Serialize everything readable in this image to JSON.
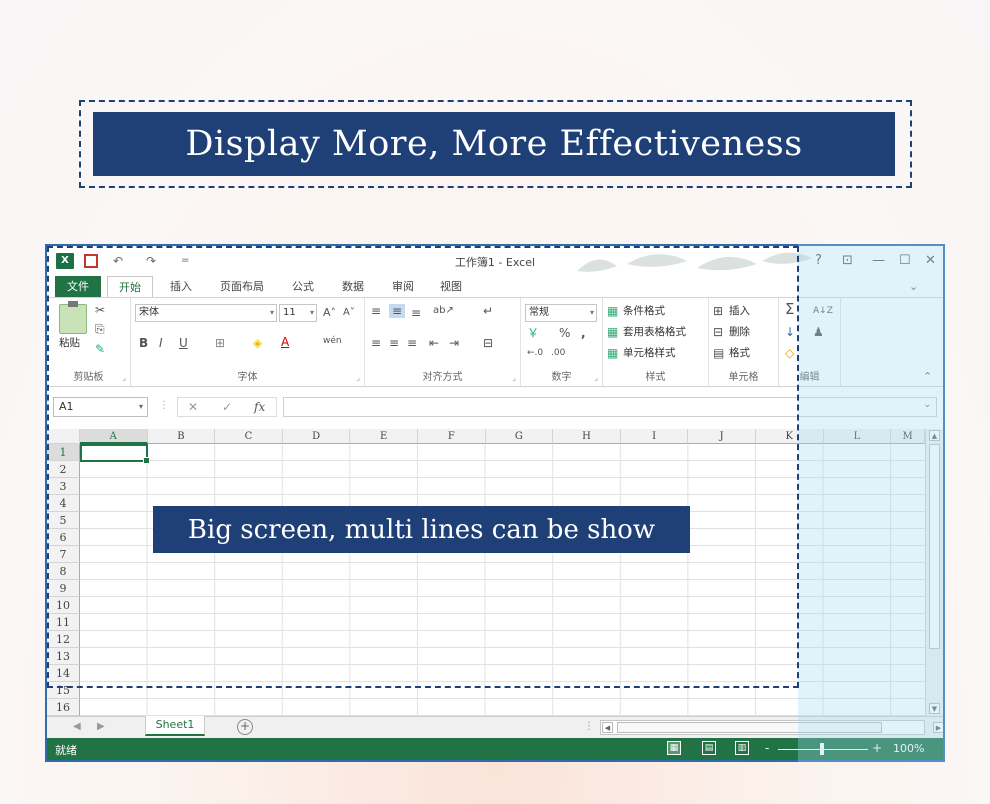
{
  "banner": {
    "title": "Display More, More Effectiveness"
  },
  "callout": {
    "text": "Big screen, multi lines can be show"
  },
  "window": {
    "title": "工作簿1 - Excel",
    "logo": "X",
    "undo": "↶",
    "redo": "↷",
    "qat_more": "=",
    "help": "?",
    "options": "⊡",
    "minimize": "—",
    "maximize": "☐",
    "close": "✕"
  },
  "tabs": [
    "文件",
    "开始",
    "插入",
    "页面布局",
    "公式",
    "数据",
    "审阅",
    "视图"
  ],
  "ribbon": {
    "clipboard": {
      "label": "剪贴板",
      "paste": "粘贴",
      "cut": "✂",
      "copy": "⎘",
      "painter": "✎"
    },
    "font": {
      "label": "字体",
      "name": "宋体",
      "size": "11",
      "grow": "A˄",
      "shrink": "A˅",
      "bold": "B",
      "italic": "I",
      "underline": "U",
      "border": "⊞",
      "fill": "◈",
      "color": "A",
      "phonetic": "wén"
    },
    "alignment": {
      "label": "对齐方式",
      "top": "≡",
      "middle": "≡",
      "bottom": "≡",
      "orient": "ab↗",
      "left": "≡",
      "center": "≡",
      "right": "≡",
      "outdent": "⇤",
      "indent": "⇥",
      "wrap": "↵",
      "merge": "⊟"
    },
    "number": {
      "label": "数字",
      "format": "常规",
      "currency": "￥",
      "percent": "%",
      "comma": ",",
      "inc": "←.0",
      "dec": ".00"
    },
    "styles": {
      "label": "样式",
      "conditional": "条件格式",
      "table": "套用表格格式",
      "cell": "单元格样式"
    },
    "cells": {
      "label": "单元格",
      "insert": "插入",
      "delete": "删除",
      "format": "格式"
    },
    "editing": {
      "label": "编辑",
      "sum": "Σ",
      "sort": "A↓Z",
      "fill": "↓",
      "find": "♟",
      "clear": "◇"
    },
    "expand": "⌃"
  },
  "formula_bar": {
    "name_box": "A1",
    "cancel": "✕",
    "enter": "✓",
    "fx": "fx",
    "value": ""
  },
  "columns": [
    "A",
    "B",
    "C",
    "D",
    "E",
    "F",
    "G",
    "H",
    "I",
    "J",
    "K",
    "L",
    "M"
  ],
  "rows": [
    "1",
    "2",
    "3",
    "4",
    "5",
    "6",
    "7",
    "8",
    "9",
    "10",
    "11",
    "12",
    "13",
    "14",
    "15",
    "16"
  ],
  "sheets": {
    "active": "Sheet1",
    "add": "+",
    "prev": "◀",
    "next": "▶"
  },
  "status": {
    "ready": "就绪",
    "zoom": "100%",
    "zoom_minus": "-",
    "zoom_plus": "+"
  },
  "colors": {
    "brand_navy": "#1f3f77",
    "excel_green": "#217346"
  }
}
